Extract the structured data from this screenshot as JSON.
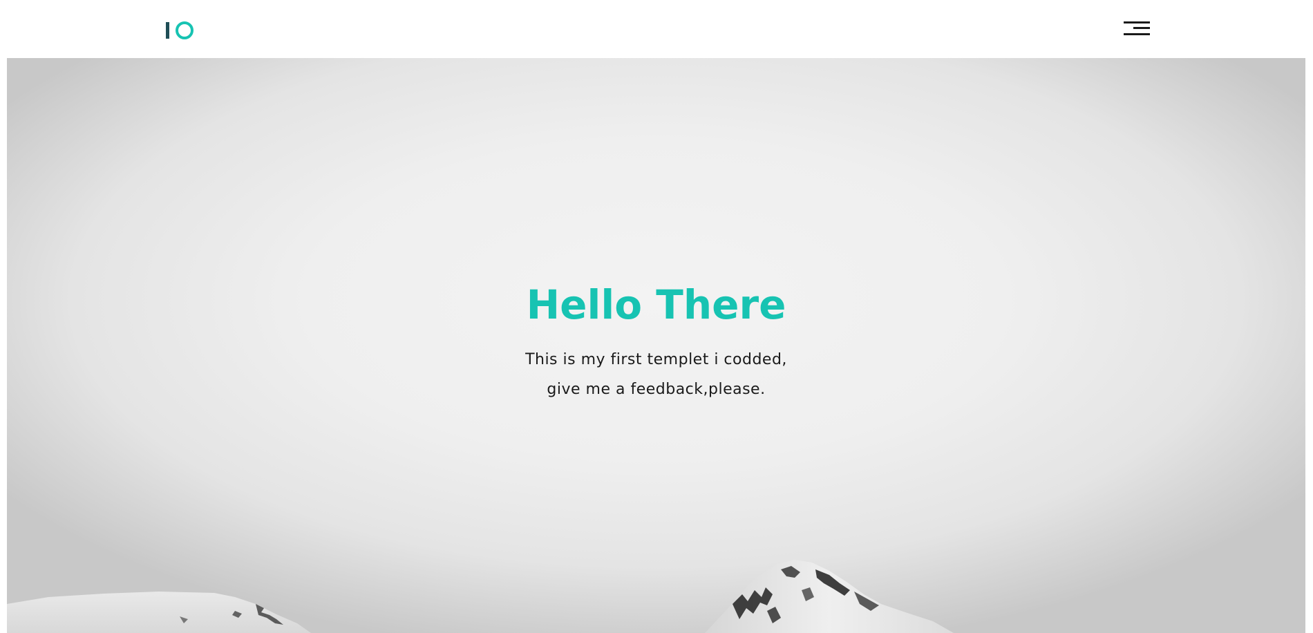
{
  "header": {
    "logo_name": "logo-mark",
    "menu_icon": "hamburger-menu-icon"
  },
  "hero": {
    "title": "Hello There",
    "text_line1": "This is my first templet i codded,",
    "text_line2": "give me a feedback,please."
  },
  "colors": {
    "accent": "#17c3b2",
    "logo_bar": "#1f4e57",
    "text": "#1a1a1a"
  }
}
